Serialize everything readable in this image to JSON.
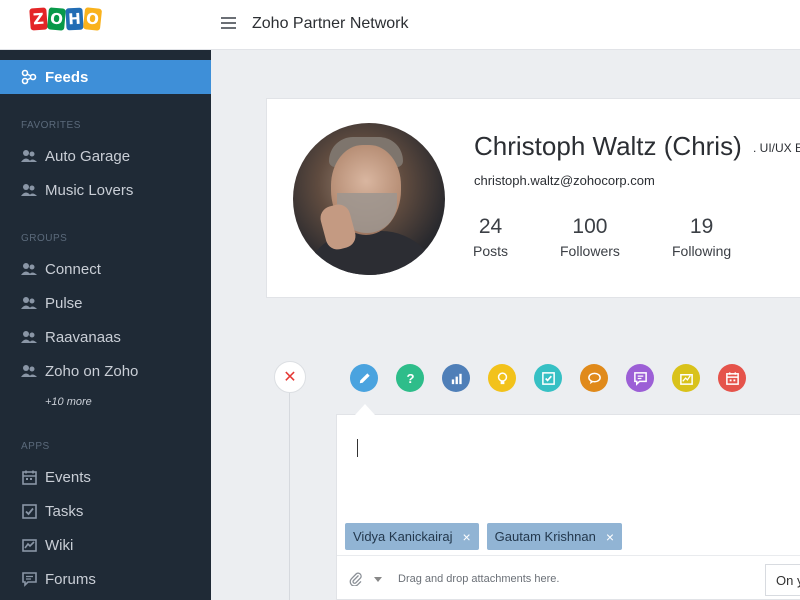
{
  "header": {
    "logo_text": "ZOHO",
    "title": "Zoho Partner Network"
  },
  "sidebar": {
    "feeds_label": "Feeds",
    "favorites_heading": "FAVORITES",
    "favorites": [
      "Auto Garage",
      "Music Lovers"
    ],
    "groups_heading": "GROUPS",
    "groups": [
      "Connect",
      "Pulse",
      "Raavanaas",
      "Zoho on Zoho"
    ],
    "more_label": "+10 more",
    "apps_heading": "APPS",
    "apps": [
      {
        "label": "Events",
        "icon": "calendar-icon"
      },
      {
        "label": "Tasks",
        "icon": "checkbox-icon"
      },
      {
        "label": "Wiki",
        "icon": "wiki-icon"
      },
      {
        "label": "Forums",
        "icon": "forum-icon"
      }
    ]
  },
  "profile": {
    "name": "Christoph Waltz (Chris)",
    "role": ". UI/UX E",
    "email": "christoph.waltz@zohocorp.com",
    "stats": [
      {
        "value": "24",
        "label": "Posts"
      },
      {
        "value": "100",
        "label": "Followers"
      },
      {
        "value": "19",
        "label": "Following"
      }
    ]
  },
  "composer": {
    "close_icon": "close-icon",
    "post_types": [
      {
        "icon": "pencil-icon",
        "color": "#4aa3df"
      },
      {
        "icon": "question-icon",
        "color": "#2ebd8a"
      },
      {
        "icon": "bar-chart-icon",
        "color": "#4f7fb8"
      },
      {
        "icon": "lightbulb-icon",
        "color": "#f2c21b"
      },
      {
        "icon": "checklist-icon",
        "color": "#36c0c4"
      },
      {
        "icon": "discussion-icon",
        "color": "#e08a1b"
      },
      {
        "icon": "message-icon",
        "color": "#9c5fd6"
      },
      {
        "icon": "announcement-icon",
        "color": "#d9c21a"
      },
      {
        "icon": "event-icon",
        "color": "#e5534b"
      }
    ],
    "tags": [
      "Vidya Kanickairaj",
      "Gautam Krishnan"
    ],
    "tag_remove": "×",
    "attach_placeholder": "Drag and drop attachments here.",
    "visibility_value": "On y"
  },
  "colors": {
    "sidebar_bg": "#1f2a36",
    "active": "#3e8fd8",
    "tag_bg": "#91b4d4"
  }
}
